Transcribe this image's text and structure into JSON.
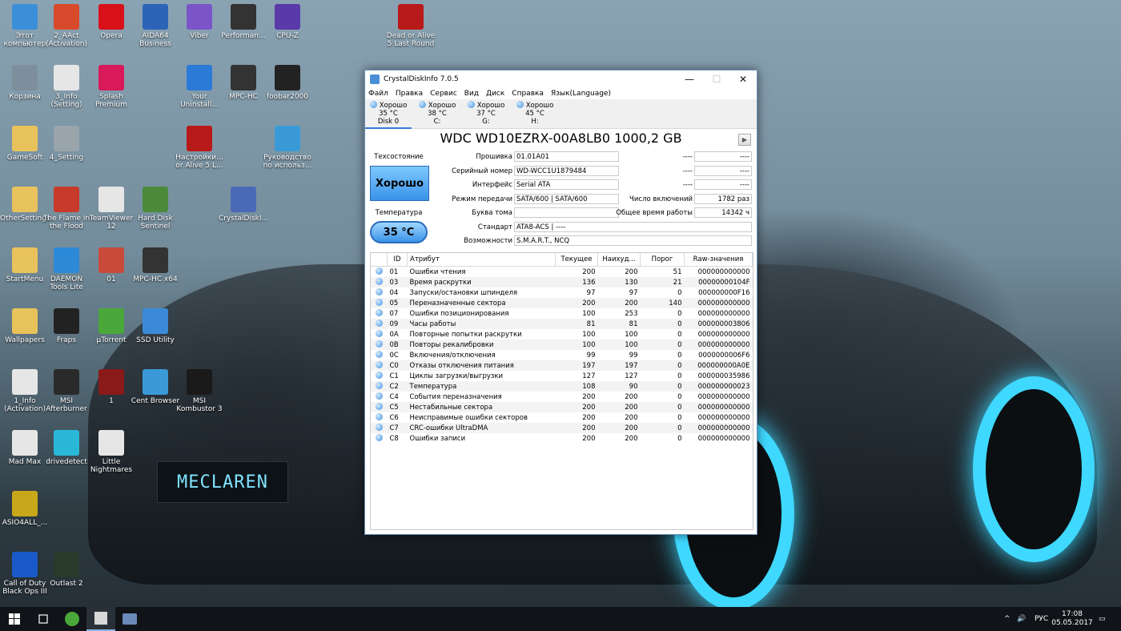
{
  "desktop": {
    "icons": [
      {
        "label": "Этот компьютер",
        "icon": "computer-icon",
        "color": "#3b8fd8"
      },
      {
        "label": "2_AAct (Activation)",
        "icon": "windows-icon",
        "color": "#d84a2b"
      },
      {
        "label": "Opera",
        "icon": "opera-icon",
        "color": "#d8101a"
      },
      {
        "label": "AIDA64 Business",
        "icon": "aida64-icon",
        "color": "#2c64b8"
      },
      {
        "label": "Viber",
        "icon": "viber-icon",
        "color": "#7b55c8"
      },
      {
        "label": "Performan...",
        "icon": "performance-icon",
        "color": "#333333"
      },
      {
        "label": "CPU-Z",
        "icon": "cpuz-icon",
        "color": "#5a3aa8"
      },
      {
        "label": "Dead or Alive 5 Last Round",
        "icon": "doa5-icon",
        "color": "#b81a1a"
      },
      {
        "label": "Корзина",
        "icon": "recycle-bin-icon",
        "color": "#7d8f9c"
      },
      {
        "label": "3_Info (Setting)",
        "icon": "document-icon",
        "color": "#e6e6e6"
      },
      {
        "label": "Splash Premium",
        "icon": "splash-icon",
        "color": "#d81a5a"
      },
      {
        "label": "Your Uninstall...",
        "icon": "uninstaller-icon",
        "color": "#2c7ad8"
      },
      {
        "label": "MPC-HC",
        "icon": "mpc-hc-icon",
        "color": "#333333"
      },
      {
        "label": "foobar2000",
        "icon": "foobar-icon",
        "color": "#222222"
      },
      {
        "label": "GameSoft",
        "icon": "folder-icon",
        "color": "#e8c25a"
      },
      {
        "label": "4_Setting",
        "icon": "settings-icon",
        "color": "#9aa4ab"
      },
      {
        "label": "Настройки... or Alive 5 L...",
        "icon": "doa5-settings-icon",
        "color": "#b81a1a"
      },
      {
        "label": "Руководство по использ...",
        "icon": "chrome-icon",
        "color": "#3a9ad8"
      },
      {
        "label": "OtherSettings",
        "icon": "folder-icon",
        "color": "#e8c25a"
      },
      {
        "label": "The Flame in the Flood",
        "icon": "flame-flood-icon",
        "color": "#c83a2a"
      },
      {
        "label": "TeamViewer 12",
        "icon": "document-icon",
        "color": "#e6e6e6"
      },
      {
        "label": "Hard Disk Sentinel",
        "icon": "hdsentinel-icon",
        "color": "#4a8a3a"
      },
      {
        "label": "CrystalDiskI...",
        "icon": "crystaldisk-icon",
        "color": "#4a6ab8"
      },
      {
        "label": "StartMenu",
        "icon": "folder-icon",
        "color": "#e8c25a"
      },
      {
        "label": "DAEMON Tools Lite",
        "icon": "daemon-tools-icon",
        "color": "#2c8ad8"
      },
      {
        "label": "01",
        "icon": "image-icon",
        "color": "#c84a3a"
      },
      {
        "label": "MPC-HC x64",
        "icon": "mpc-hc-icon",
        "color": "#333333"
      },
      {
        "label": "Wallpapers",
        "icon": "folder-icon",
        "color": "#e8c25a"
      },
      {
        "label": "Fraps",
        "icon": "fraps-icon",
        "color": "#222222"
      },
      {
        "label": "µTorrent",
        "icon": "utorrent-icon",
        "color": "#4aa83a"
      },
      {
        "label": "SSD Utility",
        "icon": "ssd-utility-icon",
        "color": "#3a8ad8"
      },
      {
        "label": "1_Info (Activation)",
        "icon": "document-icon",
        "color": "#e6e6e6"
      },
      {
        "label": "MSI Afterburner",
        "icon": "afterburner-icon",
        "color": "#2a2a2a"
      },
      {
        "label": "1",
        "icon": "image-icon",
        "color": "#8a1a1a"
      },
      {
        "label": "Cent Browser",
        "icon": "cent-browser-icon",
        "color": "#3a9ad8"
      },
      {
        "label": "MSI Kombustor 3",
        "icon": "kombustor-icon",
        "color": "#1a1a1a"
      },
      {
        "label": "Mad Max",
        "icon": "document-icon",
        "color": "#e6e6e6"
      },
      {
        "label": "drivedetect",
        "icon": "drivedetect-icon",
        "color": "#2ab8d8"
      },
      {
        "label": "Little Nightmares",
        "icon": "document-icon",
        "color": "#e6e6e6"
      },
      {
        "label": "ASIO4ALL_...",
        "icon": "asio-icon",
        "color": "#c8a81a"
      },
      {
        "label": "Call of Duty Black Ops III",
        "icon": "cod-icon",
        "color": "#1a5ac8"
      },
      {
        "label": "Outlast 2",
        "icon": "outlast-icon",
        "color": "#2a3a2a"
      }
    ],
    "plate_text": "MECLAREN"
  },
  "window": {
    "title": "CrystalDiskInfo 7.0.5",
    "controls": {
      "minimize": "—",
      "maximize": "☐",
      "close": "✕"
    },
    "menu": [
      "Файл",
      "Правка",
      "Сервис",
      "Вид",
      "Диск",
      "Справка",
      "Язык(Language)"
    ],
    "disks": [
      {
        "status": "Хорошо",
        "temp": "35 °C",
        "name": "Disk 0"
      },
      {
        "status": "Хорошо",
        "temp": "38 °C",
        "name": "C:"
      },
      {
        "status": "Хорошо",
        "temp": "37 °C",
        "name": "G:"
      },
      {
        "status": "Хорошо",
        "temp": "45 °C",
        "name": "H:"
      }
    ],
    "model": "WDC WD10EZRX-00A8LB0 1000,2 GB",
    "health_label": "Техсостояние",
    "health_value": "Хорошо",
    "temp_label": "Температура",
    "temp_value": "35 °C",
    "fields": {
      "firmware": {
        "label": "Прошивка",
        "value": "01.01A01"
      },
      "serial": {
        "label": "Серийный номер",
        "value": "WD-WCC1U1879484"
      },
      "interface": {
        "label": "Интерфейс",
        "value": "Serial ATA"
      },
      "transfer": {
        "label": "Режим передачи",
        "value": "SATA/600 | SATA/600"
      },
      "letter": {
        "label": "Буква тома",
        "value": ""
      },
      "standard": {
        "label": "Стандарт",
        "value": "ATA8-ACS | ----"
      },
      "features": {
        "label": "Возможности",
        "value": "S.M.A.R.T., NCQ"
      },
      "right1": {
        "label": "----",
        "value": "----"
      },
      "right2": {
        "label": "----",
        "value": "----"
      },
      "right3": {
        "label": "----",
        "value": "----"
      },
      "power_count": {
        "label": "Число включений",
        "value": "1782 раз"
      },
      "power_hours": {
        "label": "Общее время работы",
        "value": "14342 ч"
      }
    },
    "table": {
      "headers": [
        "ID",
        "Атрибут",
        "Текущее",
        "Наихуд...",
        "Порог",
        "Raw-значения"
      ],
      "rows": [
        [
          "01",
          "Ошибки чтения",
          "200",
          "200",
          "51",
          "000000000000"
        ],
        [
          "03",
          "Время раскрутки",
          "136",
          "130",
          "21",
          "00000000104F"
        ],
        [
          "04",
          "Запуски/остановки шпинделя",
          "97",
          "97",
          "0",
          "000000000F16"
        ],
        [
          "05",
          "Переназначенные сектора",
          "200",
          "200",
          "140",
          "000000000000"
        ],
        [
          "07",
          "Ошибки позиционирования",
          "100",
          "253",
          "0",
          "000000000000"
        ],
        [
          "09",
          "Часы работы",
          "81",
          "81",
          "0",
          "000000003806"
        ],
        [
          "0A",
          "Повторные попытки раскрутки",
          "100",
          "100",
          "0",
          "000000000000"
        ],
        [
          "0B",
          "Повторы рекалибровки",
          "100",
          "100",
          "0",
          "000000000000"
        ],
        [
          "0C",
          "Включения/отключения",
          "99",
          "99",
          "0",
          "0000000006F6"
        ],
        [
          "C0",
          "Отказы отключения питания",
          "197",
          "197",
          "0",
          "000000000A0E"
        ],
        [
          "C1",
          "Циклы загрузки/выгрузки",
          "127",
          "127",
          "0",
          "000000035986"
        ],
        [
          "C2",
          "Температура",
          "108",
          "90",
          "0",
          "000000000023"
        ],
        [
          "C4",
          "События переназначения",
          "200",
          "200",
          "0",
          "000000000000"
        ],
        [
          "C5",
          "Нестабильные сектора",
          "200",
          "200",
          "0",
          "000000000000"
        ],
        [
          "C6",
          "Неисправимые ошибки секторов",
          "200",
          "200",
          "0",
          "000000000000"
        ],
        [
          "C7",
          "CRC-ошибки UltraDMA",
          "200",
          "200",
          "0",
          "000000000000"
        ],
        [
          "C8",
          "Ошибки записи",
          "200",
          "200",
          "0",
          "000000000000"
        ]
      ]
    }
  },
  "taskbar": {
    "language": "РУС",
    "time": "17:08",
    "date": "05.05.2017"
  },
  "colors": {
    "accent": "#3a93e8",
    "taskbar": "#101418"
  }
}
